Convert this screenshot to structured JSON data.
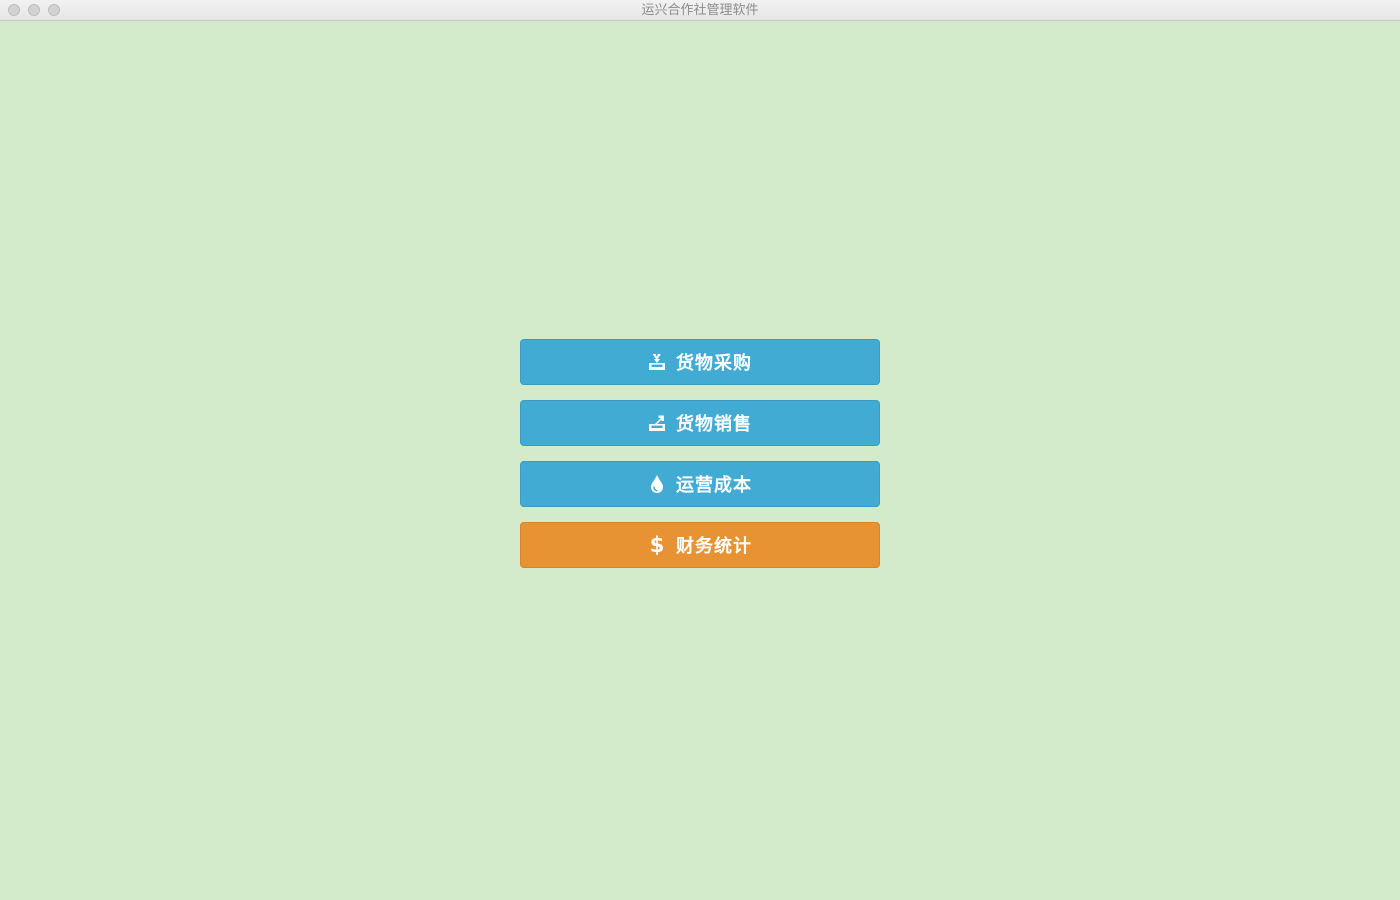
{
  "window": {
    "title": "运兴合作社管理软件"
  },
  "menu": {
    "buttons": [
      {
        "label": "货物采购",
        "icon": "inbox-download-icon",
        "color": "#42abd3"
      },
      {
        "label": "货物销售",
        "icon": "inbox-upload-icon",
        "color": "#42abd3"
      },
      {
        "label": "运营成本",
        "icon": "water-drop-icon",
        "color": "#42abd3"
      },
      {
        "label": "财务统计",
        "icon": "dollar-icon",
        "icon_glyph": "$",
        "color": "#e89333"
      }
    ]
  },
  "colors": {
    "background": "#d3ebca",
    "primary": "#42abd3",
    "accent": "#e89333"
  }
}
